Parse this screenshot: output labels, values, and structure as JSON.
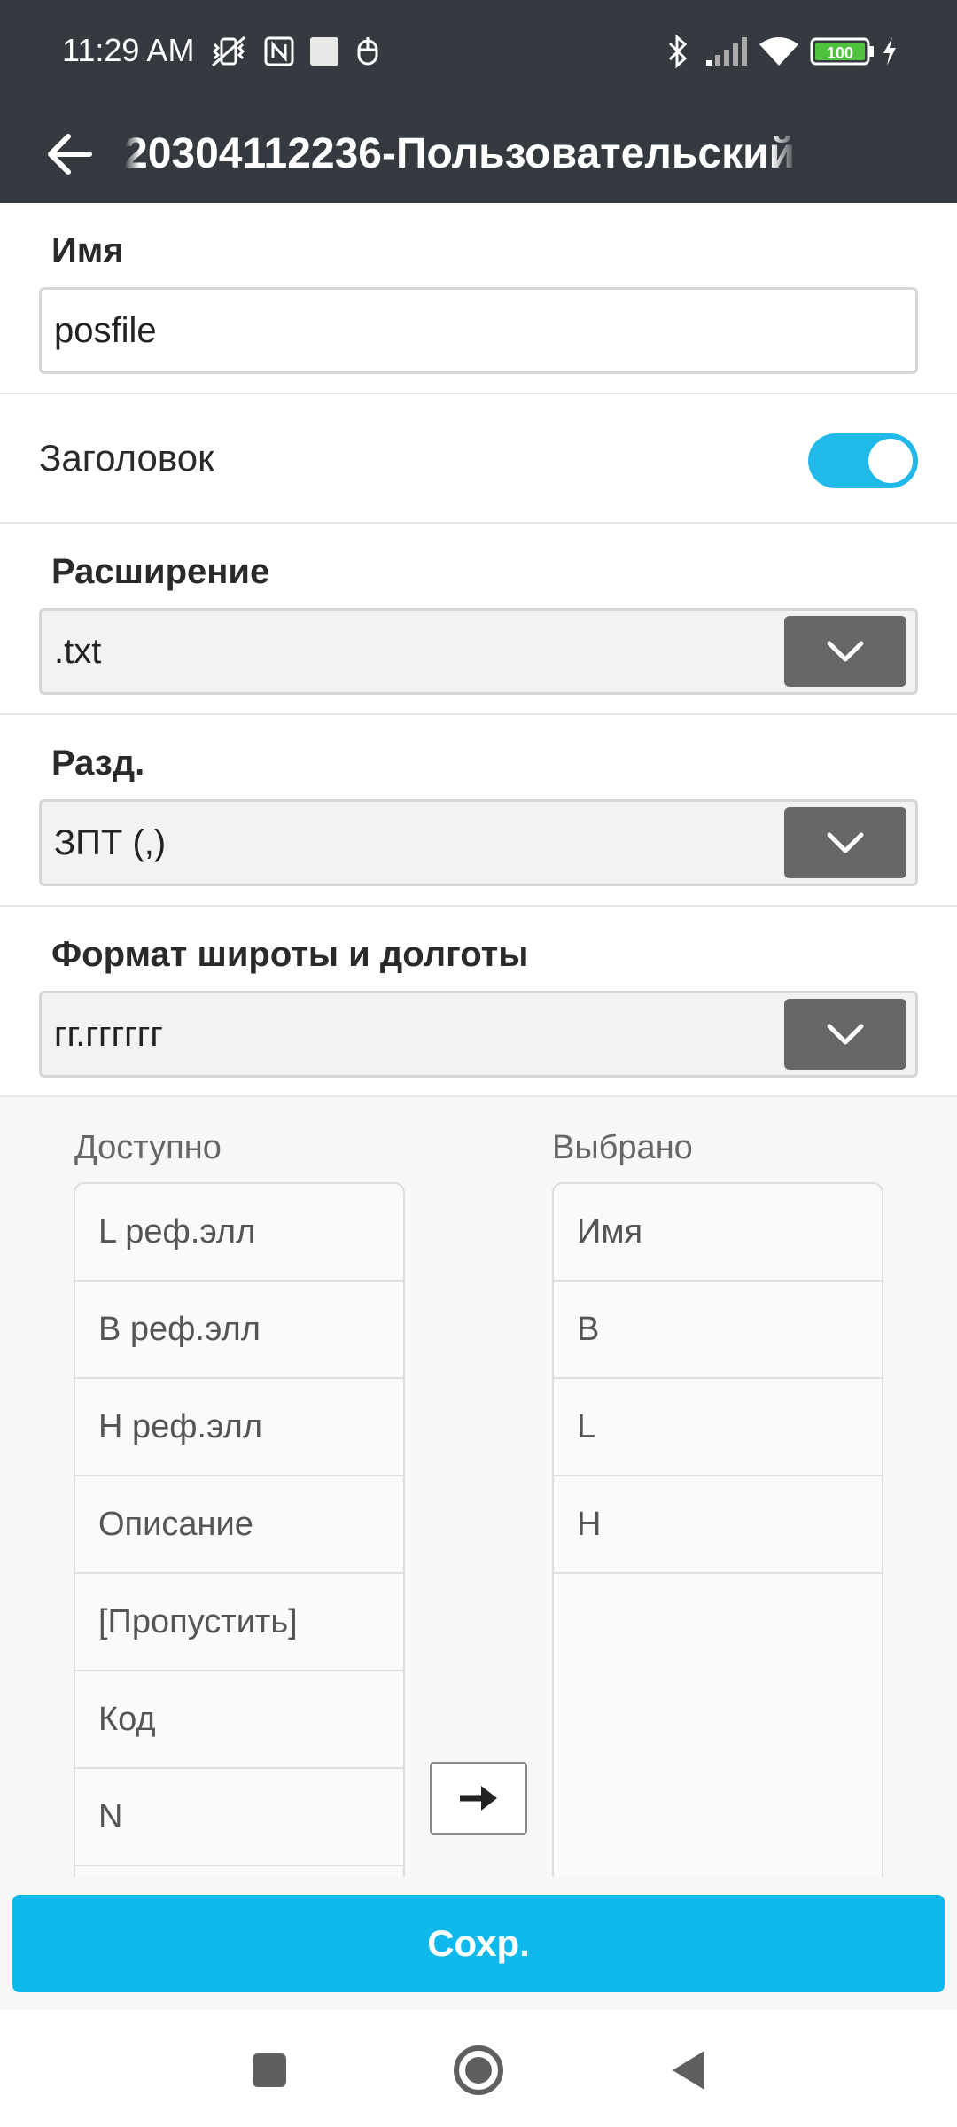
{
  "status_bar": {
    "time": "11:29 AM",
    "battery": "100",
    "icons": [
      "muted-vibrate-icon",
      "nfc-icon",
      "notification-square-icon",
      "mouse-icon",
      "bluetooth-icon",
      "signal-icon",
      "wifi-icon",
      "battery-icon",
      "charging-icon"
    ]
  },
  "app_bar": {
    "back_icon": "arrow-left-icon",
    "title": "20304112236-Пользовательский"
  },
  "form": {
    "name": {
      "label": "Имя",
      "value": "posfile"
    },
    "header": {
      "label": "Заголовок",
      "enabled": true
    },
    "extension": {
      "label": "Расширение",
      "value": ".txt"
    },
    "delimiter": {
      "label": "Разд.",
      "value": "ЗПТ (,)"
    },
    "latlon_format": {
      "label": "Формат широты и долготы",
      "value": "гг.гггггг"
    }
  },
  "columns": {
    "available_title": "Доступно",
    "selected_title": "Выбрано",
    "available": [
      "L реф.элл",
      "B реф.элл",
      "H реф.элл",
      "Описание",
      "[Пропустить]",
      "Код",
      "N"
    ],
    "selected": [
      "Имя",
      "B",
      "L",
      "H"
    ],
    "move_icon": "arrow-right-icon"
  },
  "save_label": "Сохр.",
  "nav": [
    "square-recents-icon",
    "circle-home-icon",
    "triangle-back-icon"
  ],
  "colors": {
    "accent": "#0fb9ec",
    "appbar": "#353a41",
    "select_button": "#676767"
  }
}
